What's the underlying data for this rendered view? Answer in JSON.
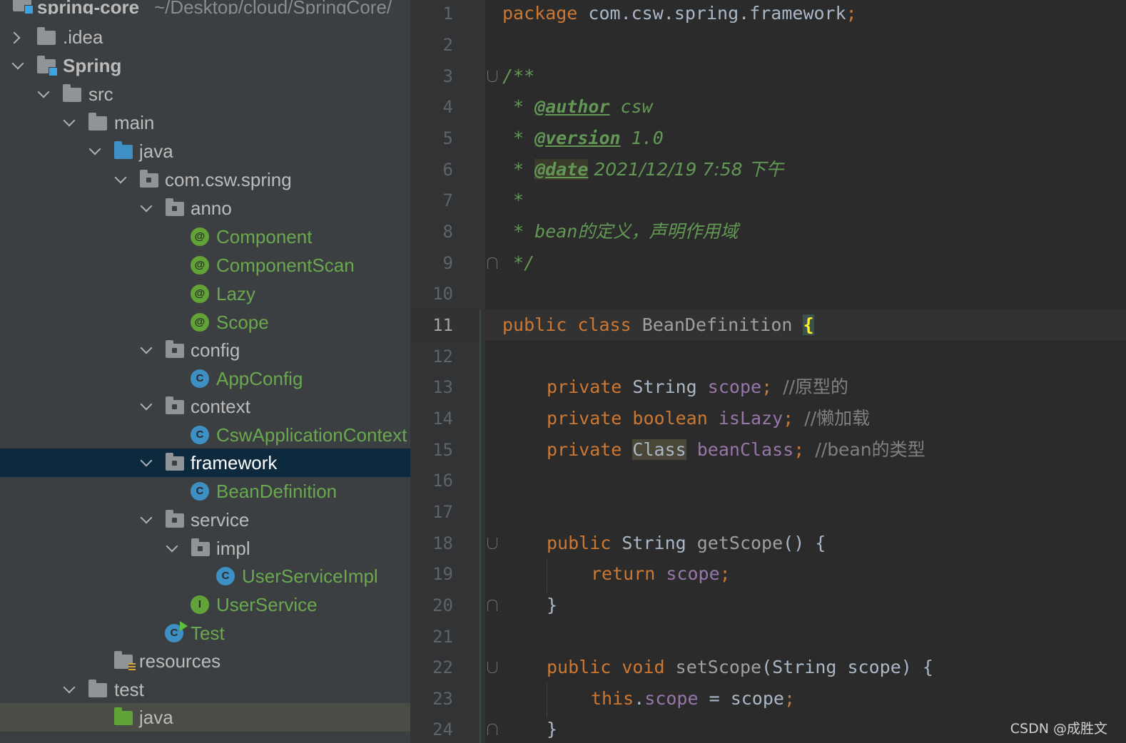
{
  "project_tree": {
    "root_name": "spring-core",
    "root_path": "~/Desktop/cloud/SpringCore/",
    "items": {
      "idea": ".idea",
      "spring": "Spring",
      "src": "src",
      "main": "main",
      "java": "java",
      "pkg": "com.csw.spring",
      "anno": "anno",
      "component": "Component",
      "componentscan": "ComponentScan",
      "lazy": "Lazy",
      "scope": "Scope",
      "config": "config",
      "appconfig": "AppConfig",
      "context": "context",
      "cswctx": "CswApplicationContext",
      "framework": "framework",
      "beandef": "BeanDefinition",
      "service": "service",
      "impl": "impl",
      "userserviceimpl": "UserServiceImpl",
      "userservice": "UserService",
      "test_class": "Test",
      "resources": "resources",
      "test": "test",
      "test_java": "java"
    },
    "icon_letters": {
      "annotation": "@",
      "class": "C",
      "interface": "I"
    }
  },
  "editor": {
    "line_numbers": [
      "1",
      "2",
      "3",
      "4",
      "5",
      "6",
      "7",
      "8",
      "9",
      "10",
      "11",
      "12",
      "13",
      "14",
      "15",
      "16",
      "17",
      "18",
      "19",
      "20",
      "21",
      "22",
      "23",
      "24"
    ],
    "current_line": "11",
    "tokens": {
      "kw_package": "package",
      "pkg_name": "com.csw.spring.framework",
      "semi": ";",
      "doc_open": "/**",
      "star": " * ",
      "tag_author": "@author",
      "author_val": " csw",
      "tag_version": "@version",
      "version_val": " 1.0",
      "tag_date": "@date",
      "date_val": " 2021/12/19 7:58 下午",
      "star_only": " *",
      "desc_en": "bean",
      "desc_cn": "的定义，声明作用域",
      "doc_close": " */",
      "kw_public": "public",
      "kw_class": "class",
      "class_name": "BeanDefinition",
      "brace_open": "{",
      "kw_private": "private",
      "type_string": "String",
      "f_scope": "scope",
      "c_scope": "//原型的",
      "type_boolean": "boolean",
      "f_islazy": "isLazy",
      "c_islazy": "//懒加载",
      "type_class": "Class",
      "f_beanclass": "beanClass",
      "c_beanclass": "//bean的类型",
      "m_getscope": "getScope",
      "parens": "()",
      "brace_open_sp": " {",
      "kw_return": "return",
      "brace_close": "}",
      "kw_void": "void",
      "m_setscope": "setScope",
      "param_open": "(",
      "param": "String scope",
      "param_close": ")",
      "kw_this": "this",
      "dot": ".",
      "assign": " = ",
      "scope_plain": "scope"
    }
  },
  "watermark": "CSDN @成胜文",
  "colors": {
    "tree_bg": "#3c3f41",
    "editor_bg": "#2b2b2b",
    "selection": "#0d293e",
    "keyword": "#cc7832",
    "field": "#9876aa",
    "doc": "#629755",
    "comment": "#808080"
  }
}
